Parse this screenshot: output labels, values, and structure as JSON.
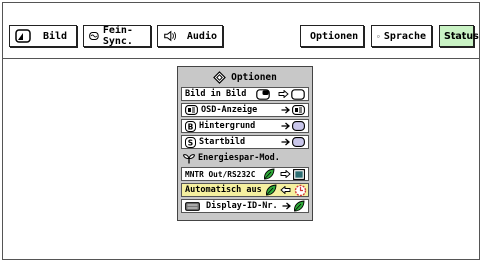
{
  "tabs": [
    {
      "label": "Bild",
      "icon": "picture-icon"
    },
    {
      "label": "Fein-Sync.",
      "icon": "fine-sync-icon"
    },
    {
      "label": "Audio",
      "icon": "speaker-icon"
    },
    {
      "label": "Optionen",
      "icon": "options-icon"
    },
    {
      "label": "Sprache",
      "icon": "language-icon"
    },
    {
      "label": "Status",
      "icon": null
    }
  ],
  "panel": {
    "title": "Optionen",
    "items": [
      {
        "label": "Bild in Bild"
      },
      {
        "label": "OSD-Anzeige"
      },
      {
        "label": "Hintergrund",
        "badge": "B"
      },
      {
        "label": "Startbild",
        "badge": "S"
      },
      {
        "label": "Energiespar-Mod."
      },
      {
        "label": "MNTR Out/RS232C"
      },
      {
        "label": "Automatisch aus"
      },
      {
        "label": "Display-ID-Nr."
      }
    ]
  },
  "colors": {
    "status_tab": "#c9f2c4",
    "highlight_row": "#f5f0a0",
    "leaf_green": "#2faa3a",
    "panel_bg": "#c8c8c8"
  }
}
